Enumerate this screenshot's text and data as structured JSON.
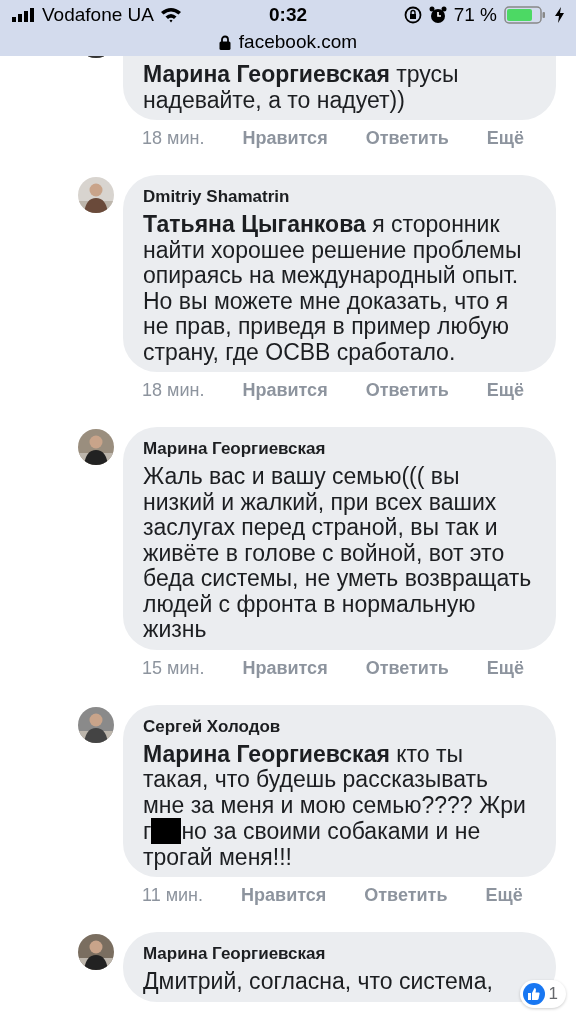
{
  "status_bar": {
    "carrier": "Vodafone UA",
    "time": "0:32",
    "battery": "71 %"
  },
  "address_bar": {
    "url": "facebook.com"
  },
  "comments": [
    {
      "text": "**Марина Георгиевская** трусы надевайте, а то надует))",
      "time": "18 мин.",
      "actions": [
        "Нравится",
        "Ответить",
        "Ещё"
      ]
    },
    {
      "author": "Dmitriy Shamatrin",
      "text": "**Татьяна Цыганкова** я сторонник найти хорошее решение проблемы опираясь на международный опыт. Но вы можете мне доказать, что я не прав, приведя в пример любую страну, где ОСВВ сработало.",
      "time": "18 мин.",
      "actions": [
        "Нравится",
        "Ответить",
        "Ещё"
      ]
    },
    {
      "author": "Марина Георгиевская",
      "text": "Жаль вас и вашу семью((( вы низкий и жалкий, при всех ваших заслугах перед страной, вы так и живёте в голове с войной, вот это беда системы, не уметь возвращать людей с фронта в нормальную жизнь",
      "time": "15 мин.",
      "actions": [
        "Нравится",
        "Ответить",
        "Ещё"
      ]
    },
    {
      "author": "Сергей Холодов",
      "text": "**Марина Георгиевская** кто ты такая, что будешь рассказывать мне за меня и мою семью???? Жри г",
      "text_after": "но за своими собаками и не трогай меня!!!",
      "time": "11 мин.",
      "actions": [
        "Нравится",
        "Ответить",
        "Ещё"
      ]
    },
    {
      "author": "Марина Георгиевская",
      "text": "Дмитрий, согласна, что система,",
      "reactions": "1"
    }
  ]
}
